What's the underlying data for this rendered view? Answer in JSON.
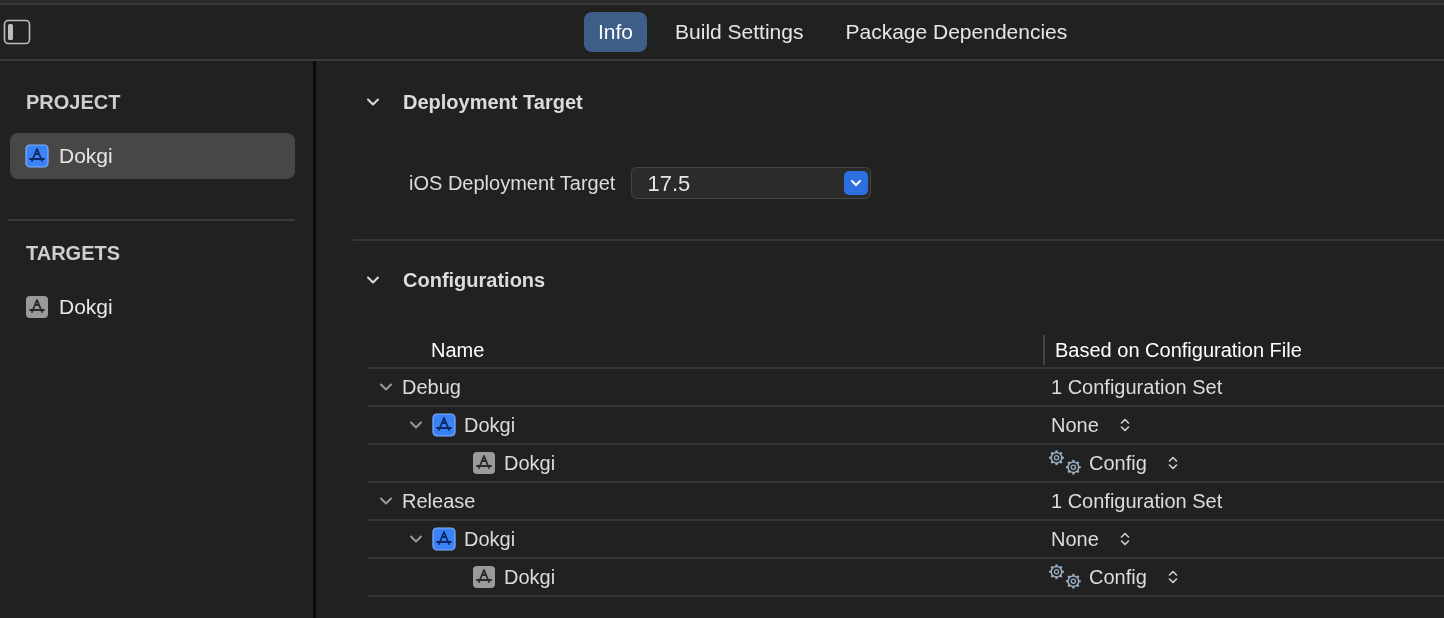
{
  "tabs": [
    {
      "label": "Info",
      "selected": true
    },
    {
      "label": "Build Settings",
      "selected": false
    },
    {
      "label": "Package Dependencies",
      "selected": false
    }
  ],
  "sidebar": {
    "sections": [
      {
        "title": "PROJECT",
        "items": [
          {
            "label": "Dokgi",
            "kind": "project",
            "selected": true
          }
        ]
      },
      {
        "title": "TARGETS",
        "items": [
          {
            "label": "Dokgi",
            "kind": "target",
            "selected": false
          }
        ]
      }
    ]
  },
  "deployment": {
    "title": "Deployment Target",
    "expanded": true,
    "label": "iOS Deployment Target",
    "value": "17.5"
  },
  "configurations": {
    "title": "Configurations",
    "expanded": true,
    "columns": [
      "Name",
      "Based on Configuration File"
    ],
    "rows": [
      {
        "name": "Debug",
        "kind": "config",
        "expanded": true,
        "value": "1 Configuration Set",
        "children": [
          {
            "name": "Dokgi",
            "kind": "project",
            "expanded": true,
            "value": "None",
            "children": [
              {
                "name": "Dokgi",
                "kind": "target",
                "value": "Config"
              }
            ]
          }
        ]
      },
      {
        "name": "Release",
        "kind": "config",
        "expanded": true,
        "value": "1 Configuration Set",
        "children": [
          {
            "name": "Dokgi",
            "kind": "project",
            "expanded": true,
            "value": "None",
            "children": [
              {
                "name": "Dokgi",
                "kind": "target",
                "value": "Config"
              }
            ]
          }
        ]
      }
    ]
  }
}
